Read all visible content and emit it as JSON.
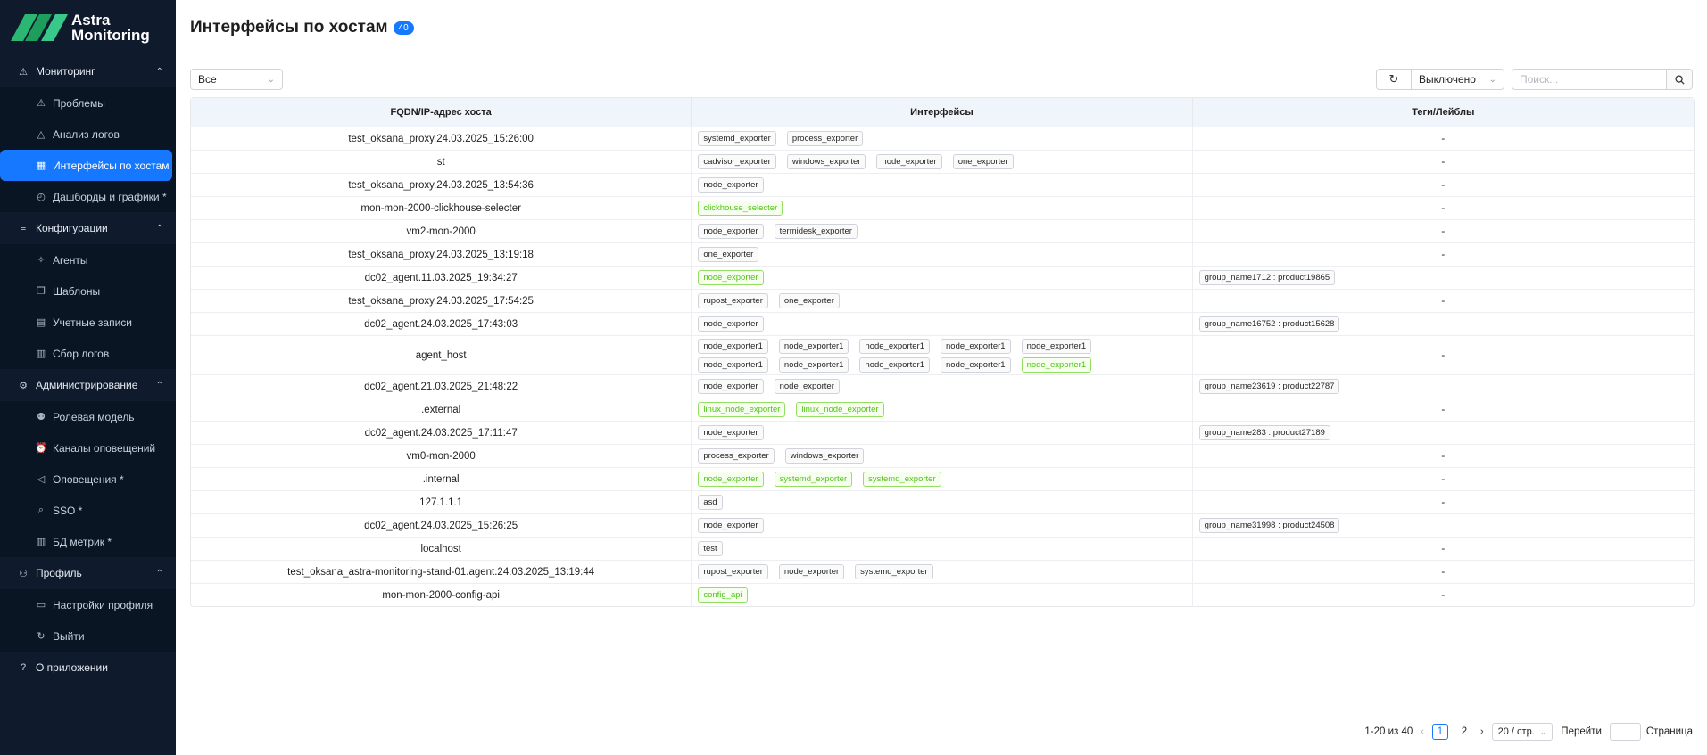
{
  "brand": {
    "line1": "Astra",
    "line2": "Monitoring"
  },
  "sidebar": {
    "sections": [
      {
        "label": "Мониторинг",
        "icon": "warning-icon",
        "items": [
          {
            "label": "Проблемы",
            "icon": "warning-icon"
          },
          {
            "label": "Анализ логов",
            "icon": "bell-icon"
          },
          {
            "label": "Интерфейсы по хостам",
            "icon": "grid-icon",
            "active": true
          },
          {
            "label": "Дашборды и графики *",
            "icon": "gauge-icon"
          }
        ]
      },
      {
        "label": "Конфигурации",
        "icon": "sliders-icon",
        "items": [
          {
            "label": "Агенты",
            "icon": "rocket-icon"
          },
          {
            "label": "Шаблоны",
            "icon": "copy-icon"
          },
          {
            "label": "Учетные записи",
            "icon": "account-icon"
          },
          {
            "label": "Сбор логов",
            "icon": "log-icon"
          }
        ]
      },
      {
        "label": "Администрирование",
        "icon": "gear-icon",
        "items": [
          {
            "label": "Ролевая модель",
            "icon": "users-icon"
          },
          {
            "label": "Каналы оповещений",
            "icon": "alarm-icon"
          },
          {
            "label": "Оповещения *",
            "icon": "megaphone-icon"
          },
          {
            "label": "SSO *",
            "icon": "key-icon"
          },
          {
            "label": "БД метрик *",
            "icon": "database-icon"
          }
        ]
      },
      {
        "label": "Профиль",
        "icon": "user-icon",
        "items": [
          {
            "label": "Настройки профиля",
            "icon": "profile-card-icon"
          },
          {
            "label": "Выйти",
            "icon": "logout-icon"
          }
        ]
      }
    ],
    "about": {
      "label": "О приложении",
      "icon": "help-icon"
    }
  },
  "header": {
    "title": "Интерфейсы по хостам",
    "count": "40"
  },
  "toolbar": {
    "filter_value": "Все",
    "refresh_value": "Выключено",
    "search_placeholder": "Поиск..."
  },
  "table": {
    "columns": [
      "FQDN/IP-адрес хоста",
      "Интерфейсы",
      "Теги/Лейблы"
    ],
    "rows": [
      {
        "host": "test_oksana_proxy.24.03.2025_15:26:00",
        "ifaces": [
          [
            "systemd_exporter",
            "process_exporter"
          ]
        ],
        "green": [],
        "tags": "-"
      },
      {
        "host": "st",
        "ifaces": [
          [
            "cadvisor_exporter",
            "windows_exporter",
            "node_exporter",
            "one_exporter"
          ]
        ],
        "green": [],
        "tags": "-"
      },
      {
        "host": "test_oksana_proxy.24.03.2025_13:54:36",
        "ifaces": [
          [
            "node_exporter"
          ]
        ],
        "green": [],
        "tags": "-"
      },
      {
        "host": "mon-mon-2000-clickhouse-selecter",
        "ifaces": [
          [
            "clickhouse_selecter"
          ]
        ],
        "green": [
          "clickhouse_selecter"
        ],
        "tags": "-"
      },
      {
        "host": "vm2-mon-2000",
        "ifaces": [
          [
            "node_exporter",
            "termidesk_exporter"
          ]
        ],
        "green": [],
        "tags": "-"
      },
      {
        "host": "test_oksana_proxy.24.03.2025_13:19:18",
        "ifaces": [
          [
            "one_exporter"
          ]
        ],
        "green": [],
        "tags": "-"
      },
      {
        "host": "dc02_agent.11.03.2025_19:34:27",
        "ifaces": [
          [
            "node_exporter"
          ]
        ],
        "green": [
          "node_exporter"
        ],
        "tags": "group_name1712 : product19865"
      },
      {
        "host": "test_oksana_proxy.24.03.2025_17:54:25",
        "ifaces": [
          [
            "rupost_exporter",
            "one_exporter"
          ]
        ],
        "green": [],
        "tags": "-"
      },
      {
        "host": "dc02_agent.24.03.2025_17:43:03",
        "ifaces": [
          [
            "node_exporter"
          ]
        ],
        "green": [],
        "tags": "group_name16752 : product15628"
      },
      {
        "host": "agent_host",
        "ifaces": [
          [
            "node_exporter1",
            "node_exporter1",
            "node_exporter1",
            "node_exporter1",
            "node_exporter1"
          ],
          [
            "node_exporter1",
            "node_exporter1",
            "node_exporter1",
            "node_exporter1",
            "node_exporter1"
          ]
        ],
        "green": [],
        "lastGreen": true,
        "tags": "-"
      },
      {
        "host": "dc02_agent.21.03.2025_21:48:22",
        "ifaces": [
          [
            "node_exporter",
            "node_exporter"
          ]
        ],
        "green": [],
        "tags": "group_name23619 : product22787"
      },
      {
        "host": ".external",
        "ifaces": [
          [
            "linux_node_exporter",
            "linux_node_exporter"
          ]
        ],
        "green": [
          "linux_node_exporter"
        ],
        "tags": "-"
      },
      {
        "host": "dc02_agent.24.03.2025_17:11:47",
        "ifaces": [
          [
            "node_exporter"
          ]
        ],
        "green": [],
        "tags": "group_name283 : product27189"
      },
      {
        "host": "vm0-mon-2000",
        "ifaces": [
          [
            "process_exporter",
            "windows_exporter"
          ]
        ],
        "green": [],
        "tags": "-"
      },
      {
        "host": ".internal",
        "ifaces": [
          [
            "node_exporter",
            "systemd_exporter",
            "systemd_exporter"
          ]
        ],
        "green": [
          "node_exporter",
          "systemd_exporter"
        ],
        "tags": "-"
      },
      {
        "host": "127.1.1.1",
        "ifaces": [
          [
            "asd"
          ]
        ],
        "green": [],
        "tags": "-"
      },
      {
        "host": "dc02_agent.24.03.2025_15:26:25",
        "ifaces": [
          [
            "node_exporter"
          ]
        ],
        "green": [],
        "tags": "group_name31998 : product24508"
      },
      {
        "host": "localhost",
        "ifaces": [
          [
            "test"
          ]
        ],
        "green": [],
        "tags": "-"
      },
      {
        "host": "test_oksana_astra-monitoring-stand-01.agent.24.03.2025_13:19:44",
        "ifaces": [
          [
            "rupost_exporter",
            "node_exporter",
            "systemd_exporter"
          ]
        ],
        "green": [],
        "tags": "-"
      },
      {
        "host": "mon-mon-2000-config-api",
        "ifaces": [
          [
            "config_api"
          ]
        ],
        "green": [
          "config_api"
        ],
        "tags": "-"
      }
    ]
  },
  "pagination": {
    "range": "1-20 из 40",
    "pages": [
      "1",
      "2"
    ],
    "current": "1",
    "page_size": "20 / стр.",
    "goto_label": "Перейти",
    "page_label": "Страница"
  }
}
